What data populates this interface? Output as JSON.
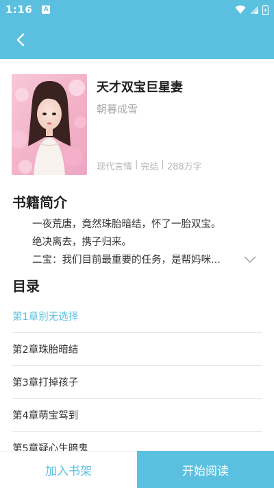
{
  "status_bar": {
    "time": "1:16",
    "notification_letter": "A"
  },
  "book": {
    "title": "天才双宝巨星妻",
    "author": "朝暮成雪",
    "genre": "现代言情",
    "status": "完结",
    "word_count": "288万字",
    "separator": "|"
  },
  "intro_section": {
    "heading": "书籍简介",
    "lines": [
      "一夜荒唐，竟然珠胎暗结，怀了一胎双宝。",
      "绝决离去，携子归来。",
      "二宝：我们目前最重要的任务，是帮妈咪..."
    ]
  },
  "toc_section": {
    "heading": "目录",
    "chapters": [
      "第1章别无选择",
      "第2章珠胎暗结",
      "第3章打掉孩子",
      "第4章萌宝驾到",
      "第5章疑心生暗鬼"
    ]
  },
  "actions": {
    "add_to_shelf": "加入书架",
    "start_reading": "开始阅读"
  },
  "colors": {
    "accent": "#5bc0e0"
  }
}
